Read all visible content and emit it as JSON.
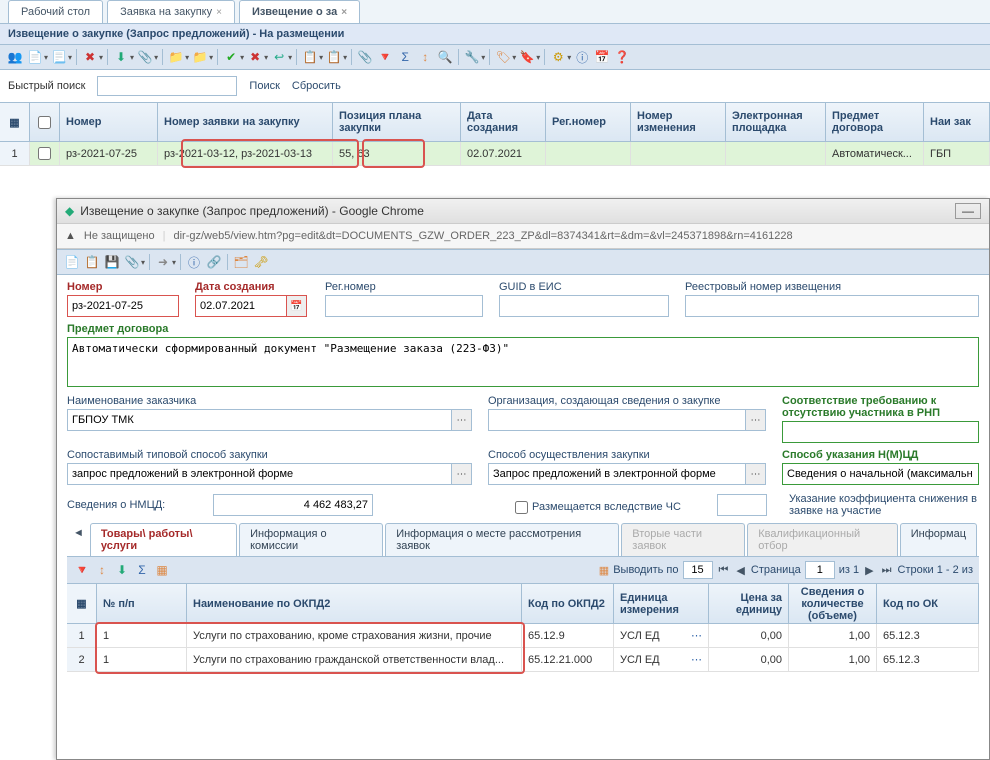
{
  "tabs": [
    "Рабочий стол",
    "Заявка на закупку",
    "Извещение о за"
  ],
  "header": "Извещение о закупке (Запрос предложений) - На размещении",
  "search": {
    "label": "Быстрый поиск",
    "btn_search": "Поиск",
    "btn_reset": "Сбросить"
  },
  "grid": {
    "cols": [
      "Номер",
      "Номер заявки на закупку",
      "Позиция плана закупки",
      "Дата создания",
      "Рег.номер",
      "Номер изменения",
      "Электронная площадка",
      "Предмет договора",
      "Наи\nзак"
    ],
    "row": {
      "num": "1",
      "nomer": "рз-2021-07-25",
      "zayavka": "рз-2021-03-12, рз-2021-03-13",
      "poz": "55, 63",
      "date": "02.07.2021",
      "reg": "",
      "izm": "",
      "plosh": "",
      "predmet": "Автоматическ...",
      "nai": "ГБП"
    }
  },
  "popup": {
    "title": "Извещение о закупке (Запрос предложений) - Google Chrome",
    "not_secure": "Не защищено",
    "url": "dir-gz/web5/view.htm?pg=edit&dt=DOCUMENTS_GZW_ORDER_223_ZP&dl=8374341&rt=&dm=&vl=245371898&rn=4161228",
    "form": {
      "nomer_lab": "Номер",
      "nomer": "рз-2021-07-25",
      "date_lab": "Дата создания",
      "date": "02.07.2021",
      "reg_lab": "Рег.номер",
      "reg": "",
      "guid_lab": "GUID в ЕИС",
      "guid": "",
      "reestr_lab": "Реестровый номер извещения",
      "reestr": "",
      "predmet_lab": "Предмет договора",
      "predmet": "Автоматически сформированный документ \"Размещение заказа (223-ФЗ)\"",
      "zakaz_lab": "Наименование заказчика",
      "zakaz": "ГБПОУ ТМК",
      "org_lab": "Организация, создающая сведения о закупке",
      "org": "",
      "rnp_lab": "Соответствие требованию к отсутствию участника в РНП",
      "rnp": "",
      "sposob1_lab": "Сопоставимый типовой способ закупки",
      "sposob1": "запрос предложений в электронной форме",
      "sposob2_lab": "Способ осуществления закупки",
      "sposob2": "Запрос предложений в электронной форме",
      "sposob3_lab": "Способ указания Н(М)ЦД",
      "sposob3": "Сведения о начальной (максимальн",
      "nmcd_lab": "Сведения о НМЦД:",
      "nmcd": "4 462 483,27",
      "chs_lab": "Размещается вследствие ЧС",
      "coef_lab": "Указание коэффициента снижения в заявке на участие"
    },
    "itabs": [
      "Товары\\ работы\\ услуги",
      "Информация о комиссии",
      "Информация о месте рассмотрения заявок",
      "Вторые части заявок",
      "Квалификационный отбор",
      "Информац"
    ],
    "pager": {
      "output_label": "Выводить по",
      "per_page": "15",
      "page_label": "Страница",
      "page": "1",
      "of": "из 1",
      "rows": "Строки 1 - 2 из"
    },
    "innergrid": {
      "cols": [
        "№ п/п",
        "Наименование по ОКПД2",
        "Код по ОКПД2",
        "Единица измерения",
        "Цена за единицу",
        "Сведения о количестве (объеме)",
        "Код по ОК"
      ],
      "rows": [
        {
          "n": "1",
          "name": "Услуги по страхованию, кроме страхования жизни, прочие",
          "okpd": "65.12.9",
          "ed": "УСЛ ЕД",
          "price": "0,00",
          "qty": "1,00",
          "okv": "65.12.3"
        },
        {
          "n": "1",
          "name": "Услуги по страхованию гражданской ответственности влад...",
          "okpd": "65.12.21.000",
          "ed": "УСЛ ЕД",
          "price": "0,00",
          "qty": "1,00",
          "okv": "65.12.3"
        }
      ]
    }
  }
}
